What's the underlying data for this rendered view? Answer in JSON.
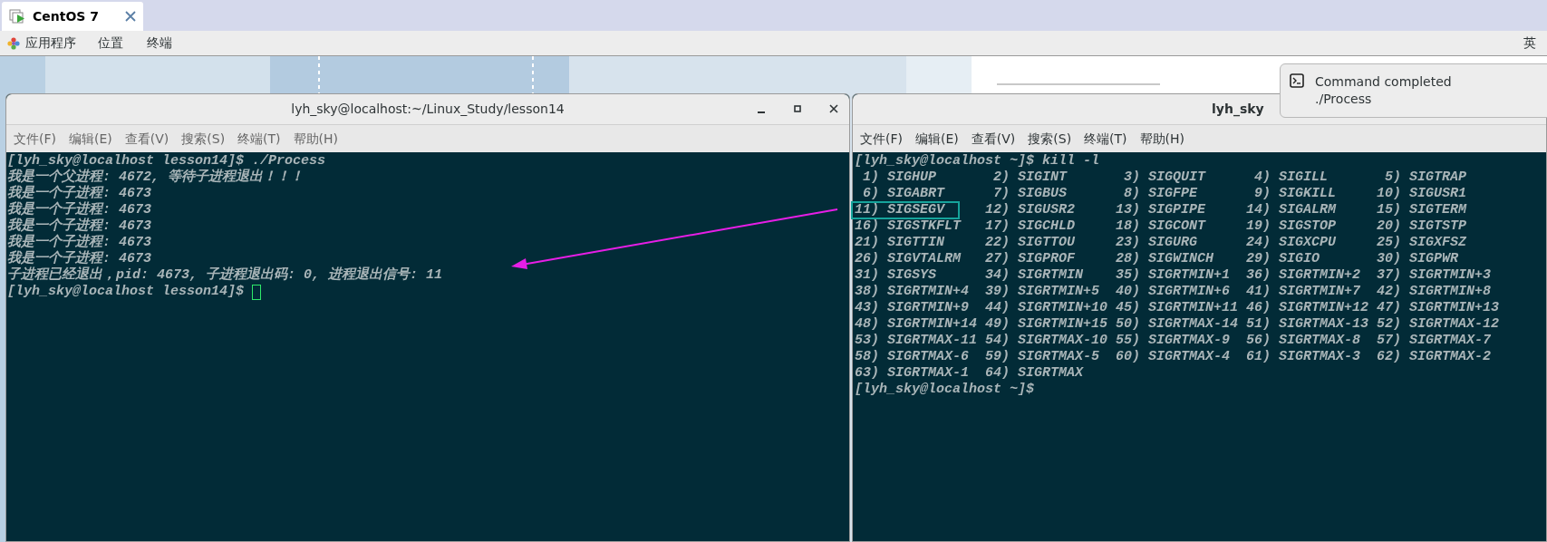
{
  "top_tabs": [
    {
      "label": "CentOS 7",
      "selected": true
    }
  ],
  "top_menu": {
    "items": [
      "应用程序",
      "位置",
      "终端"
    ],
    "input_method": "英"
  },
  "notification": {
    "title": "Command completed",
    "body": "./Process"
  },
  "windows": [
    {
      "title": "lyh_sky@localhost:~/Linux_Study/lesson14",
      "has_controls": true,
      "menu": [
        "文件(F)",
        "编辑(E)",
        "查看(V)",
        "搜索(S)",
        "终端(T)",
        "帮助(H)"
      ],
      "lines": [
        "[lyh_sky@localhost lesson14]$ ./Process",
        "我是一个父进程: 4672, 等待子进程退出！！！",
        "我是一个子进程: 4673",
        "我是一个子进程: 4673",
        "我是一个子进程: 4673",
        "我是一个子进程: 4673",
        "我是一个子进程: 4673",
        "子进程已经退出，pid: 4673, 子进程退出码: 0, 进程退出信号: 11"
      ],
      "prompt": "[lyh_sky@localhost lesson14]$",
      "cursor": true
    },
    {
      "title": "lyh_sky",
      "has_controls": false,
      "menu": [
        "文件(F)",
        "编辑(E)",
        "查看(V)",
        "搜索(S)",
        "终端(T)",
        "帮助(H)"
      ],
      "lines": [
        "[lyh_sky@localhost ~]$ kill -l"
      ],
      "signals": [
        [
          {
            "num": "1)",
            "name": "SIGHUP",
            "highlighted": false
          },
          {
            "num": "2)",
            "name": "SIGINT",
            "highlighted": false
          },
          {
            "num": "3)",
            "name": "SIGQUIT",
            "highlighted": false
          },
          {
            "num": "4)",
            "name": "SIGILL",
            "highlighted": false
          },
          {
            "num": "5)",
            "name": "SIGTRAP",
            "highlighted": false
          }
        ],
        [
          {
            "num": "6)",
            "name": "SIGABRT",
            "highlighted": false
          },
          {
            "num": "7)",
            "name": "SIGBUS",
            "highlighted": false
          },
          {
            "num": "8)",
            "name": "SIGFPE",
            "highlighted": false
          },
          {
            "num": "9)",
            "name": "SIGKILL",
            "highlighted": false
          },
          {
            "num": "10)",
            "name": "SIGUSR1",
            "highlighted": false
          }
        ],
        [
          {
            "num": "11)",
            "name": "SIGSEGV",
            "highlighted": true
          },
          {
            "num": "12)",
            "name": "SIGUSR2",
            "highlighted": false
          },
          {
            "num": "13)",
            "name": "SIGPIPE",
            "highlighted": false
          },
          {
            "num": "14)",
            "name": "SIGALRM",
            "highlighted": false
          },
          {
            "num": "15)",
            "name": "SIGTERM",
            "highlighted": false
          }
        ],
        [
          {
            "num": "16)",
            "name": "SIGSTKFLT",
            "highlighted": false
          },
          {
            "num": "17)",
            "name": "SIGCHLD",
            "highlighted": false
          },
          {
            "num": "18)",
            "name": "SIGCONT",
            "highlighted": false
          },
          {
            "num": "19)",
            "name": "SIGSTOP",
            "highlighted": false
          },
          {
            "num": "20)",
            "name": "SIGTSTP",
            "highlighted": false
          }
        ],
        [
          {
            "num": "21)",
            "name": "SIGTTIN",
            "highlighted": false
          },
          {
            "num": "22)",
            "name": "SIGTTOU",
            "highlighted": false
          },
          {
            "num": "23)",
            "name": "SIGURG",
            "highlighted": false
          },
          {
            "num": "24)",
            "name": "SIGXCPU",
            "highlighted": false
          },
          {
            "num": "25)",
            "name": "SIGXFSZ",
            "highlighted": false
          }
        ],
        [
          {
            "num": "26)",
            "name": "SIGVTALRM",
            "highlighted": false
          },
          {
            "num": "27)",
            "name": "SIGPROF",
            "highlighted": false
          },
          {
            "num": "28)",
            "name": "SIGWINCH",
            "highlighted": false
          },
          {
            "num": "29)",
            "name": "SIGIO",
            "highlighted": false
          },
          {
            "num": "30)",
            "name": "SIGPWR",
            "highlighted": false
          }
        ],
        [
          {
            "num": "31)",
            "name": "SIGSYS",
            "highlighted": false
          },
          {
            "num": "34)",
            "name": "SIGRTMIN",
            "highlighted": false
          },
          {
            "num": "35)",
            "name": "SIGRTMIN+1",
            "highlighted": false
          },
          {
            "num": "36)",
            "name": "SIGRTMIN+2",
            "highlighted": false
          },
          {
            "num": "37)",
            "name": "SIGRTMIN+3",
            "highlighted": false
          }
        ],
        [
          {
            "num": "38)",
            "name": "SIGRTMIN+4",
            "highlighted": false
          },
          {
            "num": "39)",
            "name": "SIGRTMIN+5",
            "highlighted": false
          },
          {
            "num": "40)",
            "name": "SIGRTMIN+6",
            "highlighted": false
          },
          {
            "num": "41)",
            "name": "SIGRTMIN+7",
            "highlighted": false
          },
          {
            "num": "42)",
            "name": "SIGRTMIN+8",
            "highlighted": false
          }
        ],
        [
          {
            "num": "43)",
            "name": "SIGRTMIN+9",
            "highlighted": false
          },
          {
            "num": "44)",
            "name": "SIGRTMIN+10",
            "highlighted": false
          },
          {
            "num": "45)",
            "name": "SIGRTMIN+11",
            "highlighted": false
          },
          {
            "num": "46)",
            "name": "SIGRTMIN+12",
            "highlighted": false
          },
          {
            "num": "47)",
            "name": "SIGRTMIN+13",
            "highlighted": false
          }
        ],
        [
          {
            "num": "48)",
            "name": "SIGRTMIN+14",
            "highlighted": false
          },
          {
            "num": "49)",
            "name": "SIGRTMIN+15",
            "highlighted": false
          },
          {
            "num": "50)",
            "name": "SIGRTMAX-14",
            "highlighted": false
          },
          {
            "num": "51)",
            "name": "SIGRTMAX-13",
            "highlighted": false
          },
          {
            "num": "52)",
            "name": "SIGRTMAX-12",
            "highlighted": false
          }
        ],
        [
          {
            "num": "53)",
            "name": "SIGRTMAX-11",
            "highlighted": false
          },
          {
            "num": "54)",
            "name": "SIGRTMAX-10",
            "highlighted": false
          },
          {
            "num": "55)",
            "name": "SIGRTMAX-9",
            "highlighted": false
          },
          {
            "num": "56)",
            "name": "SIGRTMAX-8",
            "highlighted": false
          },
          {
            "num": "57)",
            "name": "SIGRTMAX-7",
            "highlighted": false
          }
        ],
        [
          {
            "num": "58)",
            "name": "SIGRTMAX-6",
            "highlighted": false
          },
          {
            "num": "59)",
            "name": "SIGRTMAX-5",
            "highlighted": false
          },
          {
            "num": "60)",
            "name": "SIGRTMAX-4",
            "highlighted": false
          },
          {
            "num": "61)",
            "name": "SIGRTMAX-3",
            "highlighted": false
          },
          {
            "num": "62)",
            "name": "SIGRTMAX-2",
            "highlighted": false
          }
        ],
        [
          {
            "num": "63)",
            "name": "SIGRTMAX-1",
            "highlighted": false
          },
          {
            "num": "64)",
            "name": "SIGRTMAX",
            "highlighted": false
          }
        ]
      ],
      "prompt": "[lyh_sky@localhost ~]$",
      "cursor": false
    }
  ]
}
